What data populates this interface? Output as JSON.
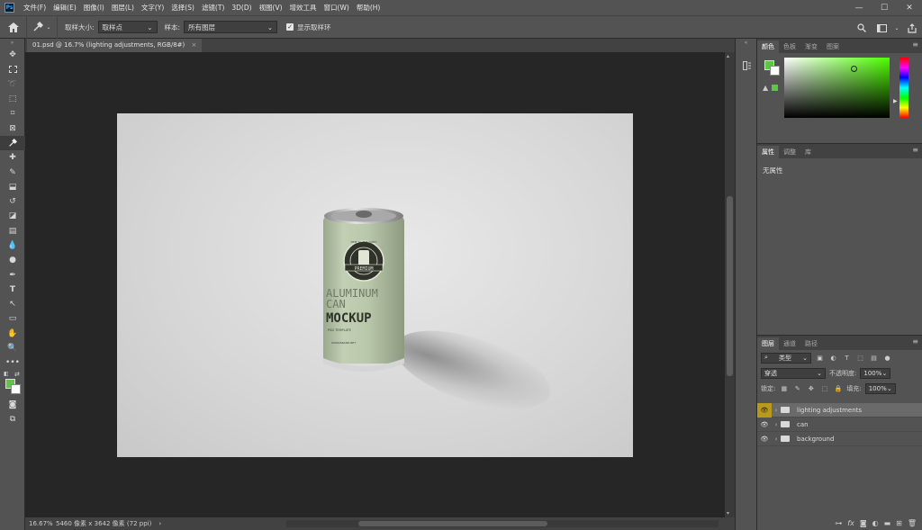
{
  "app": {
    "logo": "Ps"
  },
  "menu": [
    "文件(F)",
    "编辑(E)",
    "图像(I)",
    "图层(L)",
    "文字(Y)",
    "选择(S)",
    "滤镜(T)",
    "3D(D)",
    "视图(V)",
    "增效工具",
    "窗口(W)",
    "帮助(H)"
  ],
  "window_controls": {
    "minimize": "—",
    "maximize": "☐",
    "close": "✕"
  },
  "options": {
    "sample_size_label": "取样大小:",
    "sample_size_value": "取样点",
    "sample_label": "样本:",
    "sample_value": "所有图层",
    "show_ring_label": "显示取样环",
    "show_ring_checked": true
  },
  "document": {
    "tab_title": "01.psd @ 16.7% (lighting adjustments, RGB/8#)",
    "tab_close": "×",
    "zoom": "16.67%",
    "dimensions": "5460 像素 x 3642 像素 (72 ppi)"
  },
  "can_artwork": {
    "badge_top": "TIME TO THE PARTY",
    "badge_mid": "PREMIUM",
    "word1": "ALUMINUM",
    "word2": "CAN",
    "word3": "MOCKUP",
    "small1": "PSD TEMPLATE",
    "small2": "WWW.BRAND.NET",
    "color": "#b7c6a8"
  },
  "color_panel": {
    "tabs": [
      "颜色",
      "色板",
      "渐变",
      "图案"
    ],
    "foreground": "#5ec645",
    "background": "#ffffff"
  },
  "properties_panel": {
    "tabs": [
      "属性",
      "调整",
      "库"
    ],
    "empty_text": "无属性"
  },
  "layers_panel": {
    "tabs": [
      "图层",
      "通道",
      "路径"
    ],
    "filter_kind": "类型",
    "blend_mode": "穿透",
    "opacity_label": "不透明度:",
    "opacity_value": "100%",
    "lock_label": "锁定:",
    "fill_label": "填充:",
    "fill_value": "100%",
    "layers": [
      {
        "name": "lighting adjustments",
        "selected": true
      },
      {
        "name": "can",
        "selected": false
      },
      {
        "name": "background",
        "selected": false
      }
    ],
    "footer_icons": [
      "link-icon",
      "fx-icon",
      "mask-icon",
      "adjustment-icon",
      "group-icon",
      "new-layer-icon",
      "trash-icon"
    ]
  }
}
